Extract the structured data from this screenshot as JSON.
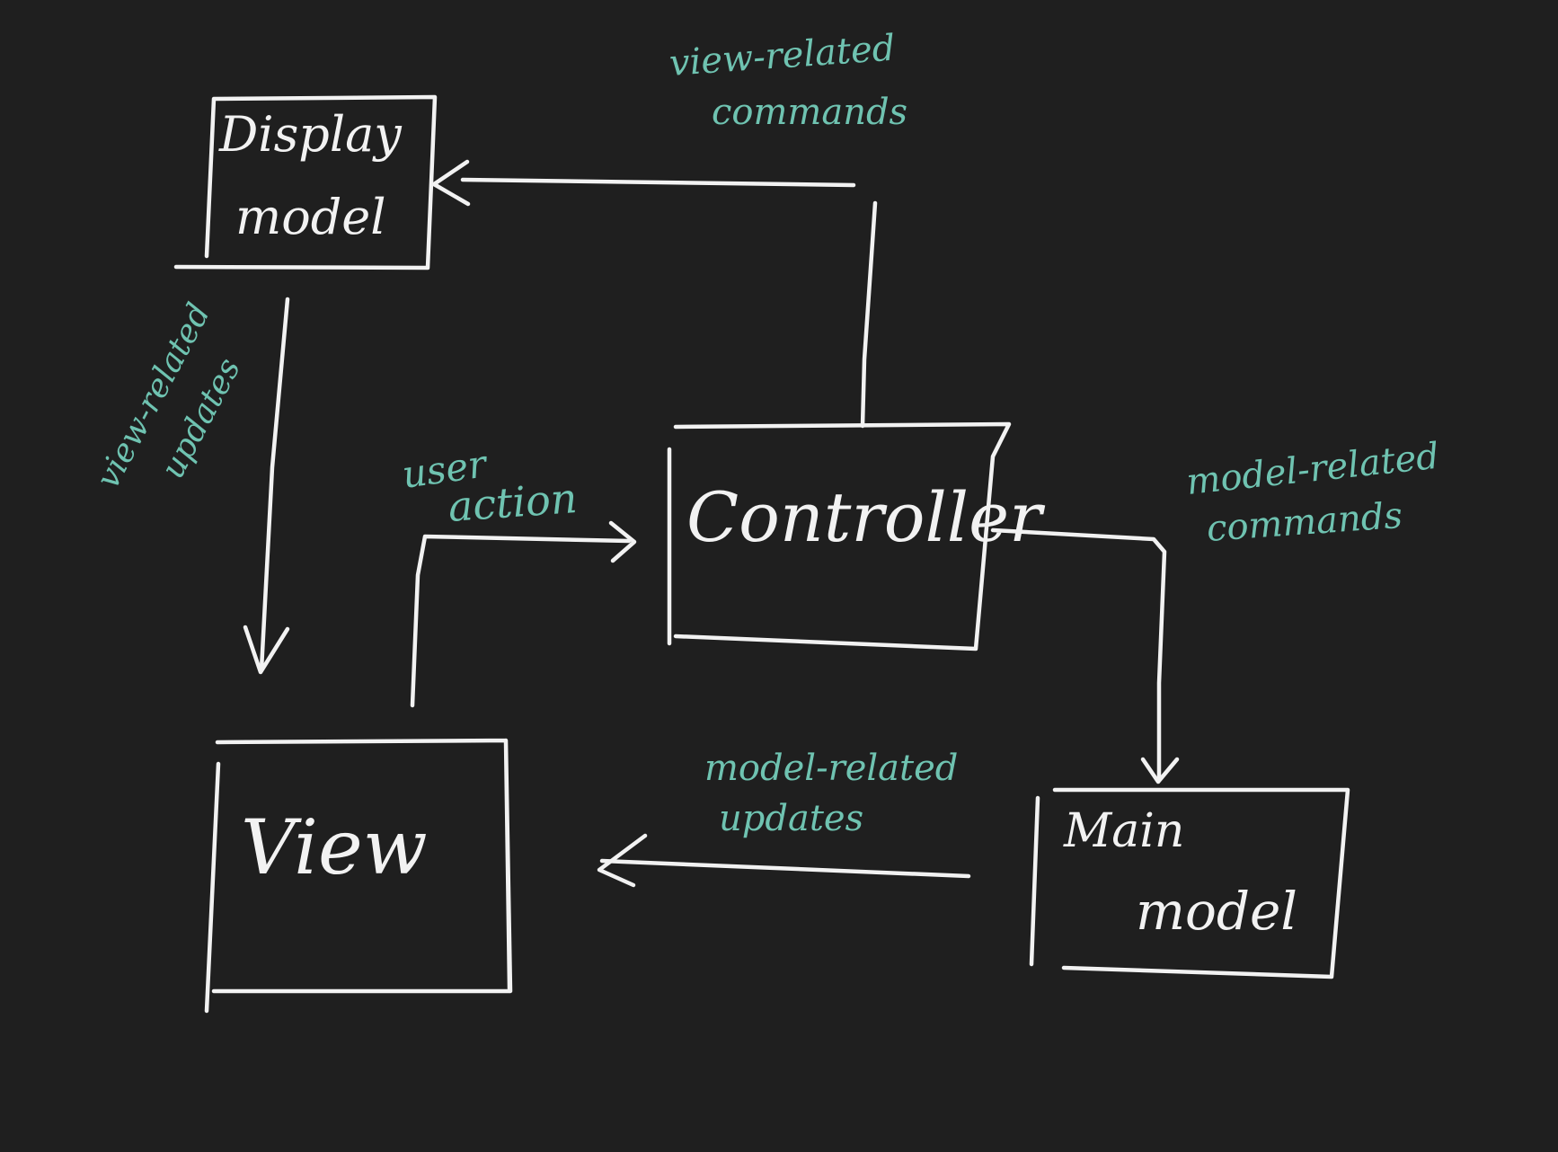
{
  "colors": {
    "background": "#1f1f1f",
    "box_stroke": "#f2f2f2",
    "note_text": "#6fc3b1"
  },
  "boxes": {
    "display_model": {
      "line1": "Display",
      "line2": "model"
    },
    "controller": {
      "label": "Controller"
    },
    "view": {
      "label": "View"
    },
    "main_model": {
      "line1": "Main",
      "line2": "model"
    }
  },
  "notes": {
    "view_commands": {
      "line1": "view-related",
      "line2": "commands"
    },
    "view_updates": {
      "line1": "view-related",
      "line2": "updates"
    },
    "user_action": {
      "line1": "user",
      "line2": "action"
    },
    "model_commands": {
      "line1": "model-related",
      "line2": "commands"
    },
    "model_updates": {
      "line1": "model-related",
      "line2": "updates"
    }
  }
}
